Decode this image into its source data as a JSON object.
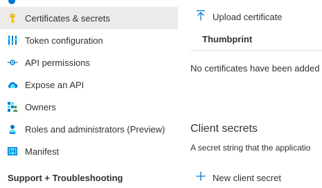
{
  "sidebar": {
    "items": [
      {
        "label": "Certificates & secrets",
        "icon": "key-icon",
        "active": true
      },
      {
        "label": "Token configuration",
        "icon": "token-configuration-icon"
      },
      {
        "label": "API permissions",
        "icon": "api-permissions-icon"
      },
      {
        "label": "Expose an API",
        "icon": "cloud-icon"
      },
      {
        "label": "Owners",
        "icon": "owners-icon"
      },
      {
        "label": "Roles and administrators (Preview)",
        "icon": "roles-icon"
      },
      {
        "label": "Manifest",
        "icon": "manifest-icon"
      }
    ],
    "section_header": "Support + Troubleshooting"
  },
  "main": {
    "certificates": {
      "upload_label": "Upload certificate",
      "column_header": "Thumbprint",
      "empty_message": "No certificates have been added"
    },
    "client_secrets": {
      "title": "Client secrets",
      "description": "A secret string that the applicatio",
      "new_label": "New client secret"
    }
  },
  "colors": {
    "accent": "#0078d4",
    "key": "#f5b400",
    "active_bg": "#edebe9"
  }
}
